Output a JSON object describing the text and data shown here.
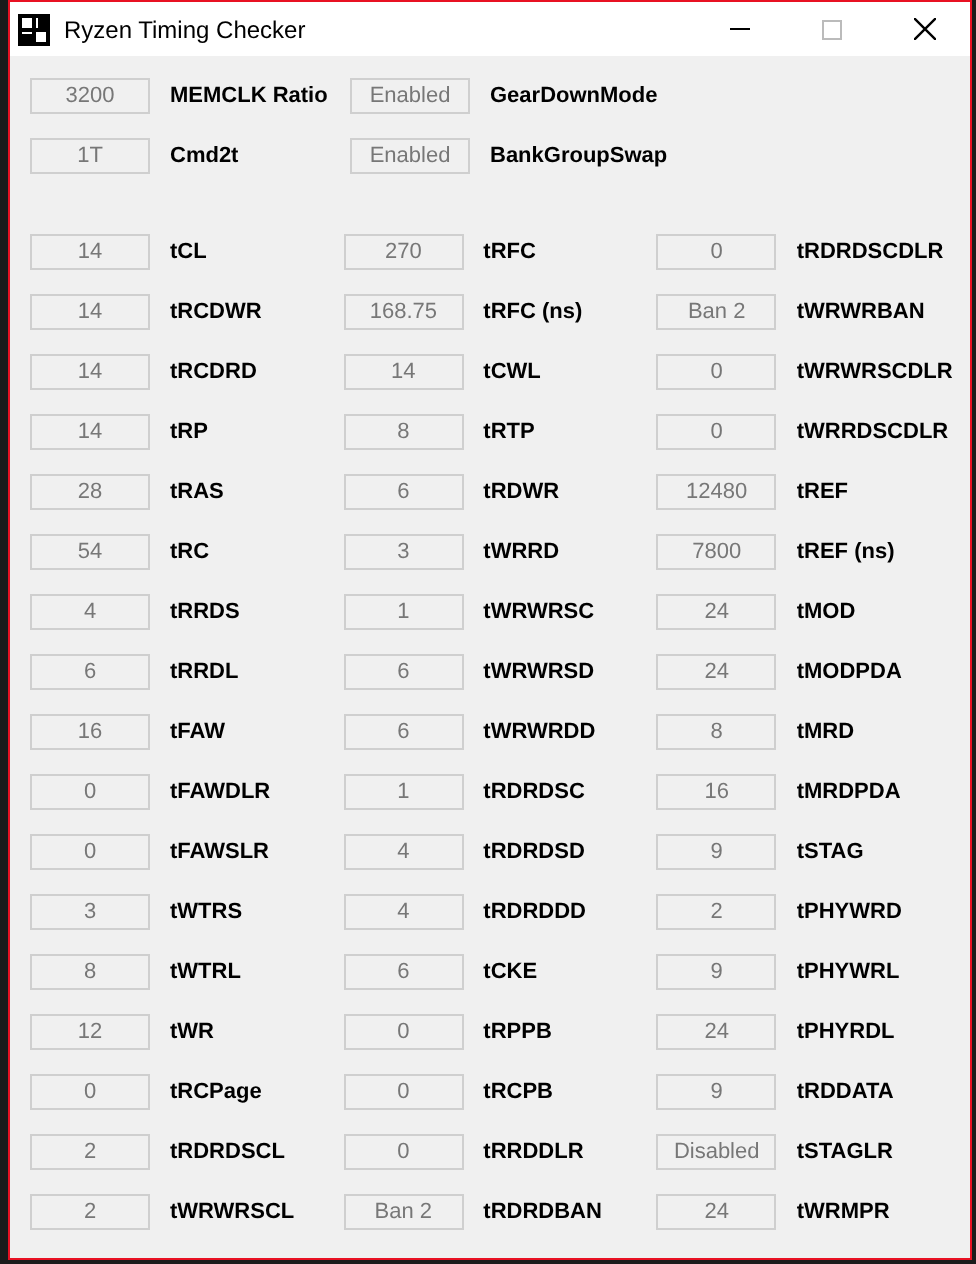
{
  "window": {
    "title": "Ryzen Timing Checker"
  },
  "settings": [
    [
      {
        "field": "3200",
        "name": "MEMCLK Ratio"
      },
      {
        "field": "Enabled",
        "name": "GearDownMode"
      }
    ],
    [
      {
        "field": "1T",
        "name": "Cmd2t"
      },
      {
        "field": "Enabled",
        "name": "BankGroupSwap"
      }
    ]
  ],
  "timings": [
    [
      {
        "field": "14",
        "name": "tCL"
      },
      {
        "field": "270",
        "name": "tRFC"
      },
      {
        "field": "0",
        "name": "tRDRDSCDLR"
      }
    ],
    [
      {
        "field": "14",
        "name": "tRCDWR"
      },
      {
        "field": "168.75",
        "name": "tRFC (ns)"
      },
      {
        "field": "Ban 2",
        "name": "tWRWRBAN"
      }
    ],
    [
      {
        "field": "14",
        "name": "tRCDRD"
      },
      {
        "field": "14",
        "name": "tCWL"
      },
      {
        "field": "0",
        "name": "tWRWRSCDLR"
      }
    ],
    [
      {
        "field": "14",
        "name": "tRP"
      },
      {
        "field": "8",
        "name": "tRTP"
      },
      {
        "field": "0",
        "name": "tWRRDSCDLR"
      }
    ],
    [
      {
        "field": "28",
        "name": "tRAS"
      },
      {
        "field": "6",
        "name": "tRDWR"
      },
      {
        "field": "12480",
        "name": "tREF"
      }
    ],
    [
      {
        "field": "54",
        "name": "tRC"
      },
      {
        "field": "3",
        "name": "tWRRD"
      },
      {
        "field": "7800",
        "name": "tREF (ns)"
      }
    ],
    [
      {
        "field": "4",
        "name": "tRRDS"
      },
      {
        "field": "1",
        "name": "tWRWRSC"
      },
      {
        "field": "24",
        "name": "tMOD"
      }
    ],
    [
      {
        "field": "6",
        "name": "tRRDL"
      },
      {
        "field": "6",
        "name": "tWRWRSD"
      },
      {
        "field": "24",
        "name": "tMODPDA"
      }
    ],
    [
      {
        "field": "16",
        "name": "tFAW"
      },
      {
        "field": "6",
        "name": "tWRWRDD"
      },
      {
        "field": "8",
        "name": "tMRD"
      }
    ],
    [
      {
        "field": "0",
        "name": "tFAWDLR"
      },
      {
        "field": "1",
        "name": "tRDRDSC"
      },
      {
        "field": "16",
        "name": "tMRDPDA"
      }
    ],
    [
      {
        "field": "0",
        "name": "tFAWSLR"
      },
      {
        "field": "4",
        "name": "tRDRDSD"
      },
      {
        "field": "9",
        "name": "tSTAG"
      }
    ],
    [
      {
        "field": "3",
        "name": "tWTRS"
      },
      {
        "field": "4",
        "name": "tRDRDDD"
      },
      {
        "field": "2",
        "name": "tPHYWRD"
      }
    ],
    [
      {
        "field": "8",
        "name": "tWTRL"
      },
      {
        "field": "6",
        "name": "tCKE"
      },
      {
        "field": "9",
        "name": "tPHYWRL"
      }
    ],
    [
      {
        "field": "12",
        "name": "tWR"
      },
      {
        "field": "0",
        "name": "tRPPB"
      },
      {
        "field": "24",
        "name": "tPHYRDL"
      }
    ],
    [
      {
        "field": "0",
        "name": "tRCPage"
      },
      {
        "field": "0",
        "name": "tRCPB"
      },
      {
        "field": "9",
        "name": "tRDDATA"
      }
    ],
    [
      {
        "field": "2",
        "name": "tRDRDSCL"
      },
      {
        "field": "0",
        "name": "tRRDDLR"
      },
      {
        "field": "Disabled",
        "name": "tSTAGLR"
      }
    ],
    [
      {
        "field": "2",
        "name": "tWRWRSCL"
      },
      {
        "field": "Ban 2",
        "name": "tRDRDBAN"
      },
      {
        "field": "24",
        "name": "tWRMPR"
      }
    ]
  ]
}
